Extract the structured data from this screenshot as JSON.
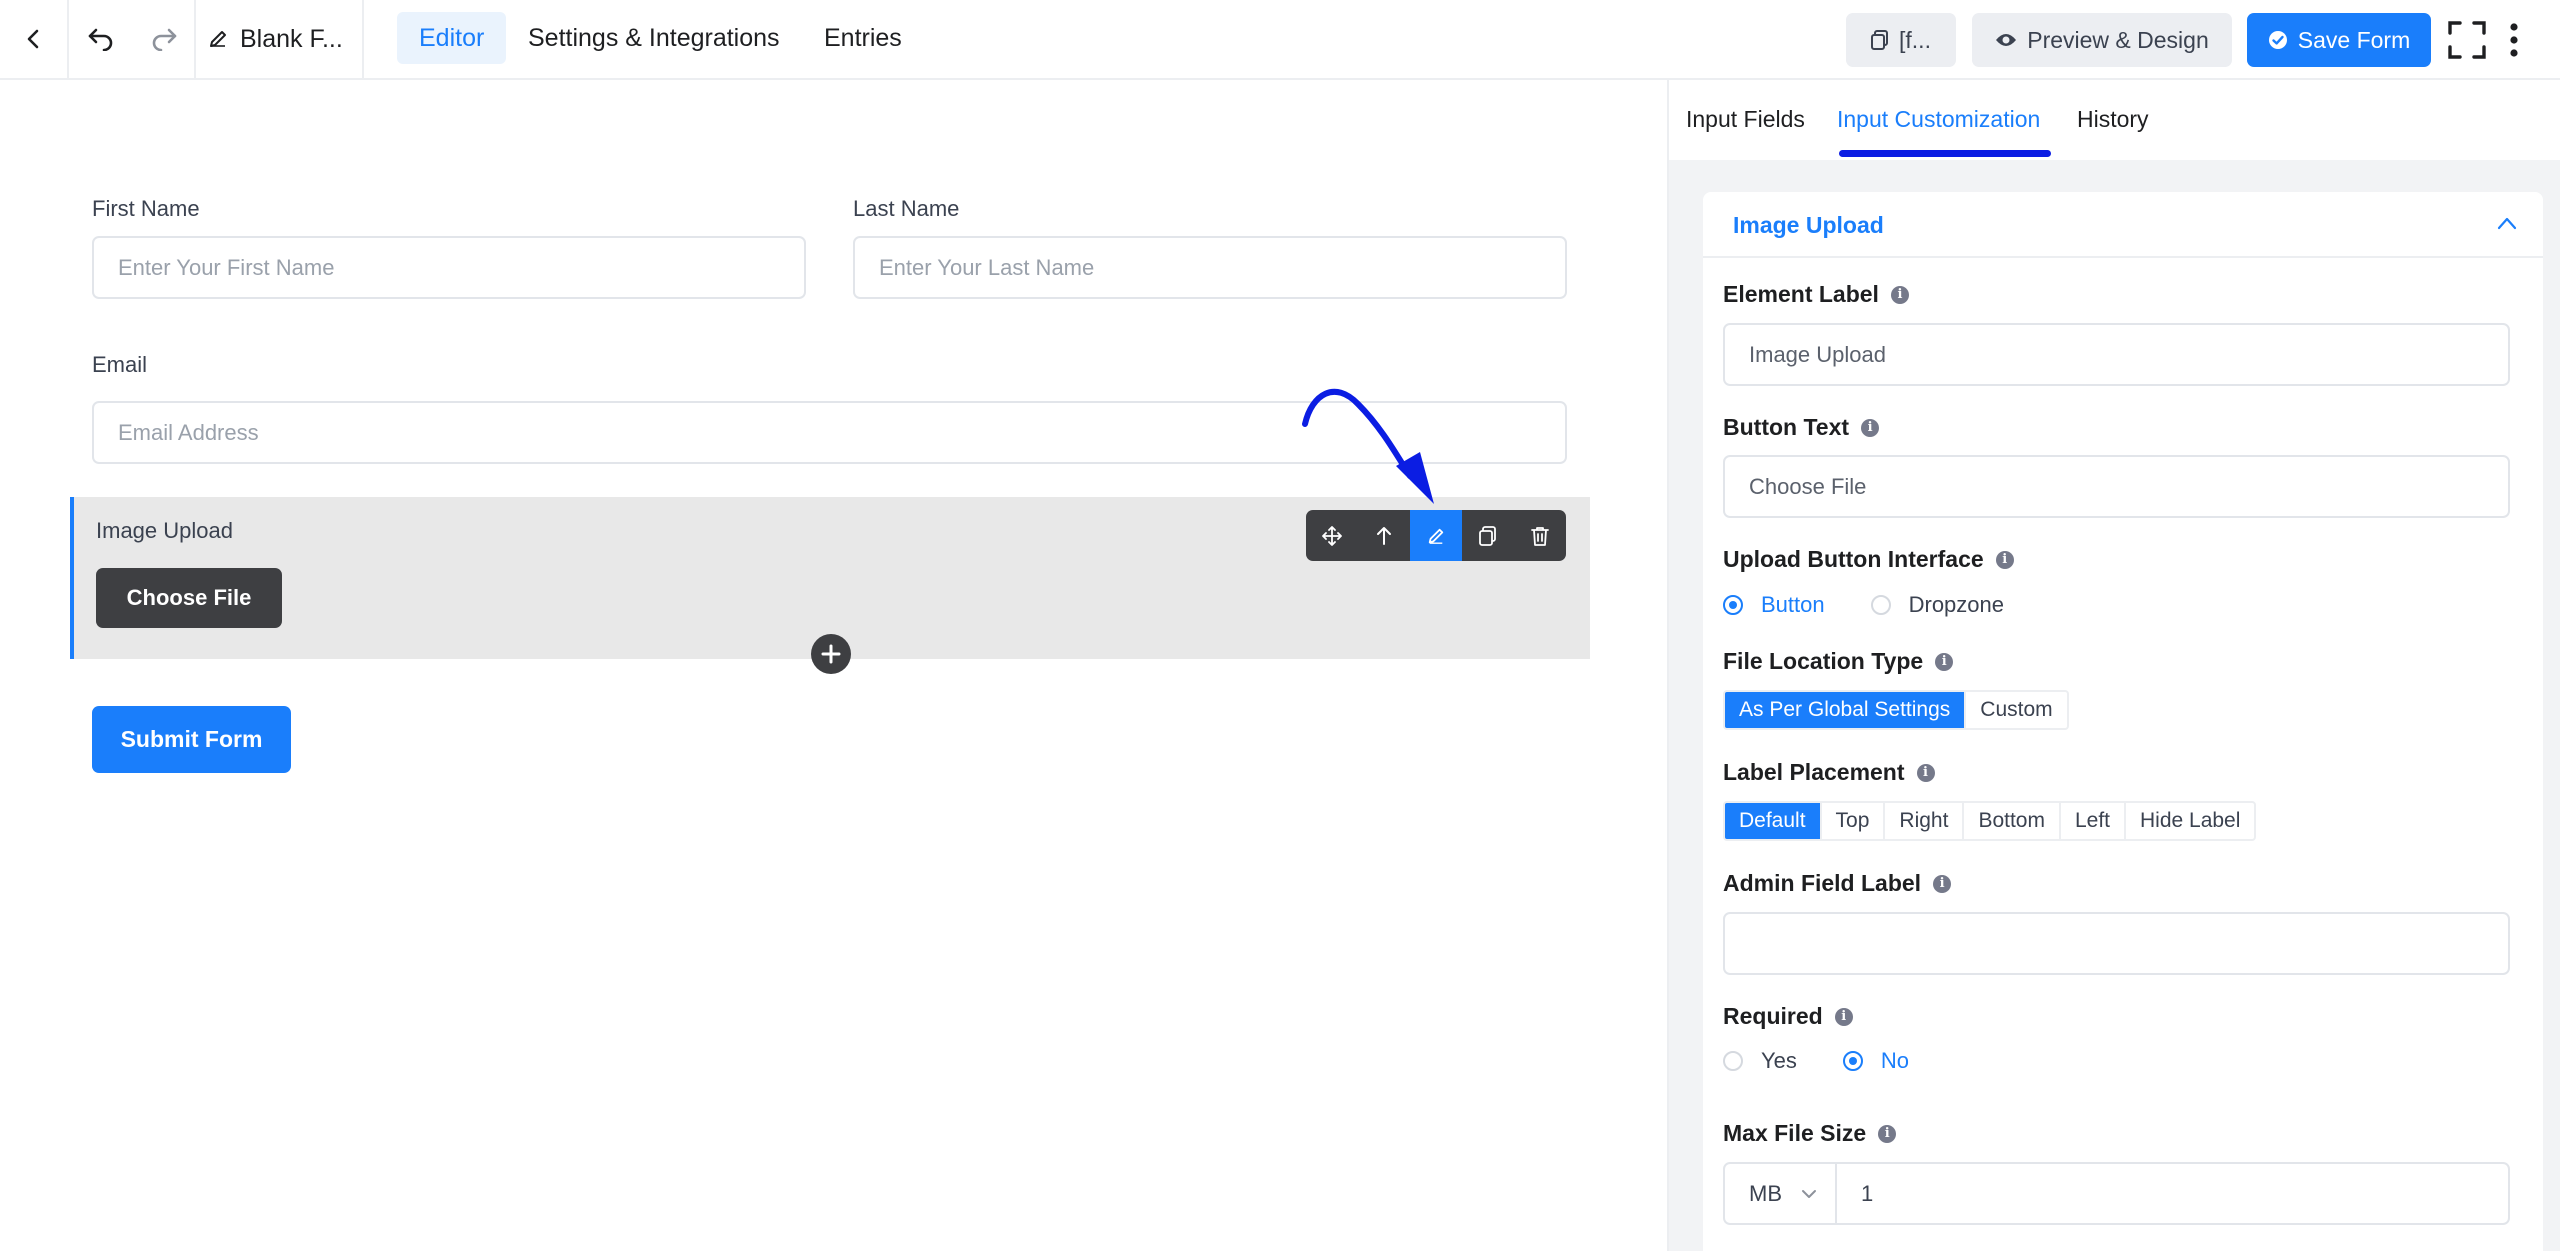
{
  "topbar": {
    "form_title": "Blank F...",
    "tabs": [
      "Editor",
      "Settings & Integrations",
      "Entries"
    ],
    "shortcode_label": "[f...",
    "preview_label": "Preview & Design",
    "save_label": "Save Form"
  },
  "form": {
    "first_name": {
      "label": "First Name",
      "placeholder": "Enter Your First Name"
    },
    "last_name": {
      "label": "Last Name",
      "placeholder": "Enter Your Last Name"
    },
    "email": {
      "label": "Email",
      "placeholder": "Email Address"
    },
    "image_upload": {
      "label": "Image Upload",
      "button": "Choose File"
    },
    "submit": "Submit Form"
  },
  "panel": {
    "tabs": [
      "Input Fields",
      "Input Customization",
      "History"
    ],
    "active_tab": "Input Customization",
    "section_title": "Image Upload",
    "element_label": {
      "label": "Element Label",
      "value": "Image Upload"
    },
    "button_text": {
      "label": "Button Text",
      "value": "Choose File"
    },
    "upload_interface": {
      "label": "Upload Button Interface",
      "options": [
        "Button",
        "Dropzone"
      ],
      "selected": "Button"
    },
    "file_location": {
      "label": "File Location Type",
      "options": [
        "As Per Global Settings",
        "Custom"
      ],
      "selected": "As Per Global Settings"
    },
    "label_placement": {
      "label": "Label Placement",
      "options": [
        "Default",
        "Top",
        "Right",
        "Bottom",
        "Left",
        "Hide Label"
      ],
      "selected": "Default"
    },
    "admin_label": {
      "label": "Admin Field Label",
      "value": ""
    },
    "required": {
      "label": "Required",
      "options": [
        "Yes",
        "No"
      ],
      "selected": "No"
    },
    "max_size": {
      "label": "Max File Size",
      "unit": "MB",
      "value": "1"
    }
  },
  "colors": {
    "accent": "#1a7efb",
    "annotation": "#0b1de3",
    "dark": "#3e3f42"
  }
}
